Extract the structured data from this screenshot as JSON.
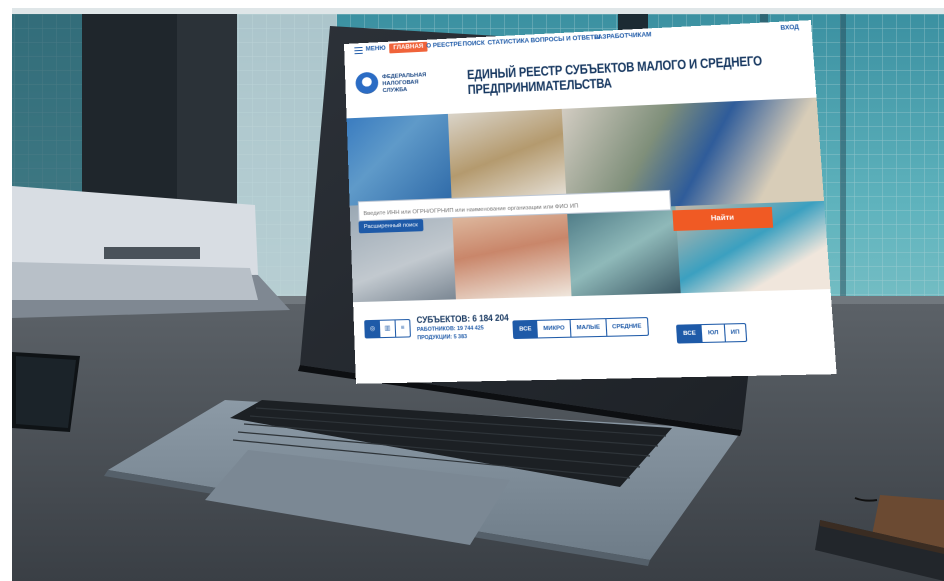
{
  "screen": {
    "nav": {
      "menu": "МЕНЮ",
      "main": "ГЛАВНАЯ",
      "about": "О РЕЕСТРЕ",
      "search": "ПОИСК",
      "stats": "СТАТИСТИКА",
      "faq": "ВОПРОСЫ И ОТВЕТЫ",
      "dev": "РАЗРАБОТЧИКАМ",
      "login": "ВХОД"
    },
    "header": {
      "org_line1": "ФЕДЕРАЛЬНАЯ",
      "org_line2": "НАЛОГОВАЯ СЛУЖБА",
      "title_line1": "ЕДИНЫЙ РЕЕСТР СУБЪЕКТОВ МАЛОГО И СРЕДНЕГО",
      "title_line2": "ПРЕДПРИНИМАТЕЛЬСТВА"
    },
    "search": {
      "placeholder": "Введите ИНН или ОГРН/ОГРНИП или наименование организации или ФИО ИП",
      "advanced": "Расширенный поиск",
      "find": "Найти"
    },
    "stats": {
      "subjects": "СУБЪЕКТОВ: 6 184 204",
      "workers": "РАБОТНИКОВ: 19 744 425",
      "products": "ПРОДУКЦИИ: 5 383"
    },
    "size_filter": [
      "ВСЕ",
      "МИКРО",
      "МАЛЫЕ",
      "СРЕДНИЕ"
    ],
    "type_filter": [
      "ВСЕ",
      "ЮЛ",
      "ИП"
    ],
    "colors": {
      "accent": "#1e5aa8",
      "find_button": "#f05a24",
      "nav_active": "#f0633a"
    }
  }
}
